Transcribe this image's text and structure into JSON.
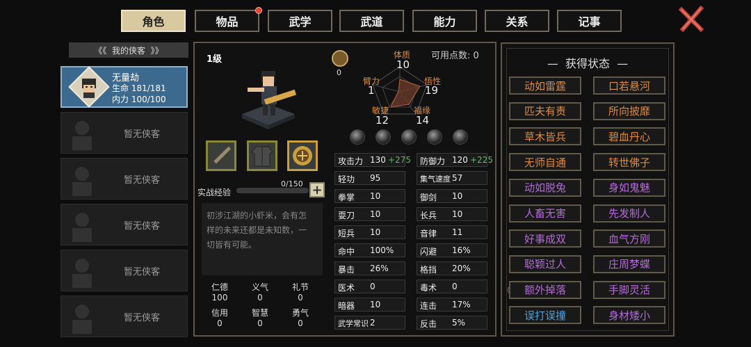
{
  "tabs": [
    "角色",
    "物品",
    "武学",
    "武道",
    "能力",
    "关系",
    "记事"
  ],
  "roster": {
    "title": "我的侠客",
    "hero": {
      "name": "无量劫",
      "hp_label": "生命",
      "hp": "181/181",
      "mp_label": "内力",
      "mp": "100/100"
    },
    "empty_label": "暂无侠客"
  },
  "character": {
    "level": "1级",
    "sword_count": "0",
    "points_label": "可用点数:",
    "points": "0",
    "stats": {
      "tizhi": {
        "label": "体质",
        "value": "10"
      },
      "biili": {
        "label": "臂力",
        "value": "1"
      },
      "wuxing": {
        "label": "悟性",
        "value": "19"
      },
      "minjie": {
        "label": "敏捷",
        "value": "12"
      },
      "fuyuan": {
        "label": "福缘",
        "value": "14"
      }
    },
    "exp_label": "实战经验",
    "exp": "0/150",
    "exp_fraction": 0,
    "description": [
      "初涉江湖的小虾米，会有怎",
      "样的未来还都是未知数，一",
      "切皆有可能。"
    ],
    "virtues": [
      {
        "name": "仁德",
        "value": "100"
      },
      {
        "name": "义气",
        "value": "0"
      },
      {
        "name": "礼节",
        "value": "0"
      },
      {
        "name": "信用",
        "value": "0"
      },
      {
        "name": "智慧",
        "value": "0"
      },
      {
        "name": "勇气",
        "value": "0"
      }
    ]
  },
  "attrs_left": [
    {
      "k": "攻击力",
      "v": "130",
      "b": "+275"
    },
    {
      "k": "轻功",
      "v": "95"
    },
    {
      "k": "拳掌",
      "v": "10"
    },
    {
      "k": "耍刀",
      "v": "10"
    },
    {
      "k": "短兵",
      "v": "10"
    },
    {
      "k": "命中",
      "v": "100%"
    },
    {
      "k": "暴击",
      "v": "26%"
    },
    {
      "k": "医术",
      "v": "0"
    },
    {
      "k": "暗器",
      "v": "10"
    },
    {
      "k": "武学常识",
      "v": "2"
    }
  ],
  "attrs_right": [
    {
      "k": "防御力",
      "v": "120",
      "b": "+225"
    },
    {
      "k": "集气速度",
      "v": "57"
    },
    {
      "k": "御剑",
      "v": "10"
    },
    {
      "k": "长兵",
      "v": "10"
    },
    {
      "k": "音律",
      "v": "11"
    },
    {
      "k": "闪避",
      "v": "16%"
    },
    {
      "k": "格挡",
      "v": "20%"
    },
    {
      "k": "毒术",
      "v": "0"
    },
    {
      "k": "连击",
      "v": "17%"
    },
    {
      "k": "反击",
      "v": "5%"
    }
  ],
  "states_title": "获得状态",
  "states": [
    {
      "t": "动如雷霆",
      "c": "orange"
    },
    {
      "t": "口若悬河",
      "c": "orange"
    },
    {
      "t": "匹夫有责",
      "c": "orange"
    },
    {
      "t": "所向披靡",
      "c": "orange"
    },
    {
      "t": "草木皆兵",
      "c": "orange"
    },
    {
      "t": "碧血丹心",
      "c": "orange"
    },
    {
      "t": "无师自通",
      "c": "orange"
    },
    {
      "t": "转世佛子",
      "c": "orange"
    },
    {
      "t": "动如脱兔",
      "c": "purple"
    },
    {
      "t": "身如鬼魅",
      "c": "purple"
    },
    {
      "t": "人畜无害",
      "c": "purple"
    },
    {
      "t": "先发制人",
      "c": "purple"
    },
    {
      "t": "好事成双",
      "c": "purple"
    },
    {
      "t": "血气方刚",
      "c": "purple"
    },
    {
      "t": "聪颖过人",
      "c": "purple"
    },
    {
      "t": "庄周梦蝶",
      "c": "purple"
    },
    {
      "t": "额外掉落",
      "c": "purple"
    },
    {
      "t": "手脚灵活",
      "c": "purple"
    },
    {
      "t": "误打误撞",
      "c": "blue"
    },
    {
      "t": "身材矮小",
      "c": "purple"
    }
  ]
}
